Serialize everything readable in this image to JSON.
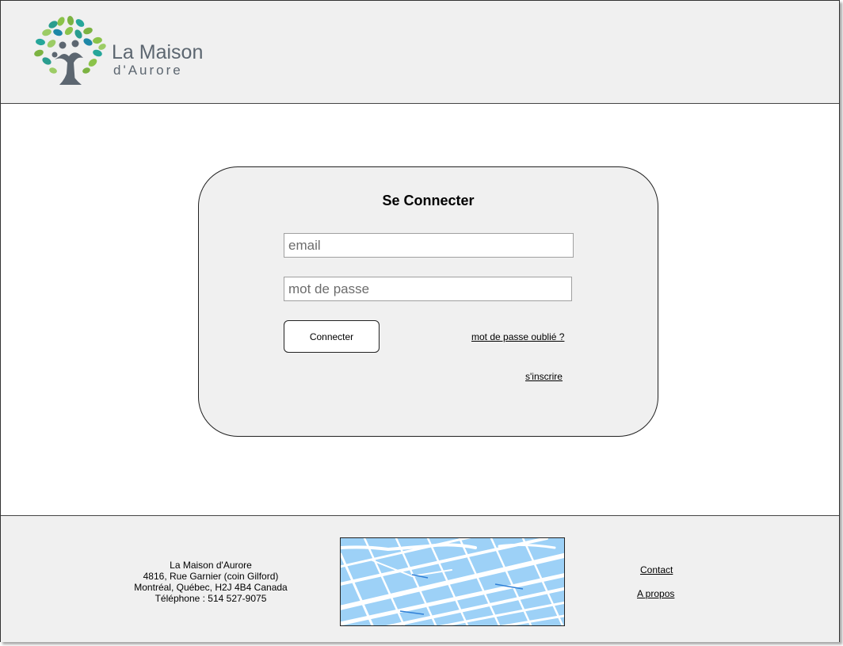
{
  "brand": {
    "name_line1": "La Maison",
    "name_line2": "d'Aurore"
  },
  "login": {
    "title": "Se Connecter",
    "email_placeholder": "email",
    "password_placeholder": "mot de passe",
    "submit_label": "Connecter",
    "forgot_password_label": "mot de passe oublié ?",
    "signup_label": "s'inscrire"
  },
  "footer": {
    "address_lines": [
      "La Maison d'Aurore",
      "4816, Rue Garnier (coin Gilford)",
      "Montréal, Québec, H2J 4B4 Canada",
      "Téléphone : 514 527-9075"
    ],
    "links": {
      "contact": "Contact",
      "about": "A propos"
    }
  },
  "colors": {
    "panel_bg": "#f0f0f0",
    "logo_text": "#5c6670",
    "map_water": "#9dd1f7"
  },
  "icons": {
    "logo": "tree-logo-icon",
    "map": "map-thumbnail"
  }
}
